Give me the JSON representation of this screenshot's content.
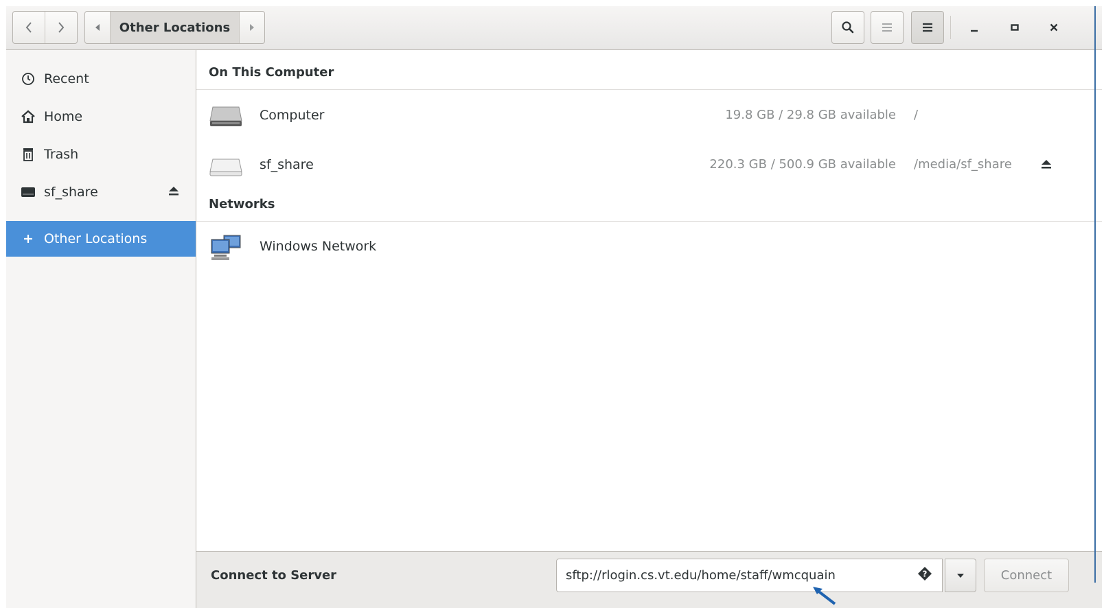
{
  "header": {
    "path_current": "Other Locations",
    "icons": {
      "back": "chevron-left-icon",
      "forward": "chevron-right-icon",
      "path_prev": "triangle-left-icon",
      "path_next": "triangle-right-icon",
      "search": "search-icon",
      "list_view": "list-view-icon",
      "menu": "hamburger-menu-icon",
      "minimize": "minimize-icon",
      "maximize": "maximize-icon",
      "close": "close-icon"
    }
  },
  "sidebar": {
    "items": [
      {
        "label": "Recent",
        "icon": "clock-icon"
      },
      {
        "label": "Home",
        "icon": "home-icon"
      },
      {
        "label": "Trash",
        "icon": "trash-icon"
      },
      {
        "label": "sf_share",
        "icon": "drive-icon",
        "eject_icon": "eject-icon"
      },
      {
        "label": "Other Locations",
        "icon": "plus-icon",
        "active": true
      }
    ]
  },
  "main": {
    "sections": [
      {
        "title": "On This Computer",
        "rows": [
          {
            "name": "Computer",
            "available": "19.8 GB / 29.8 GB available",
            "path": "/",
            "icon": "hard-drive-icon"
          },
          {
            "name": "sf_share",
            "available": "220.3 GB / 500.9 GB available",
            "path": "/media/sf_share",
            "icon": "drive-icon",
            "eject_icon": "eject-icon"
          }
        ]
      },
      {
        "title": "Networks",
        "rows": [
          {
            "name": "Windows Network",
            "icon": "network-computers-icon"
          }
        ]
      }
    ]
  },
  "bottom": {
    "label": "Connect to Server",
    "server_value": "sftp://rlogin.cs.vt.edu/home/staff/wmcquain",
    "server_placeholder": "",
    "connect_label": "Connect",
    "help_icon": "help-diamond-icon",
    "dropdown_icon": "dropdown-arrow-icon"
  },
  "colors": {
    "accent": "#4a90d9",
    "sidebar_bg": "#f6f5f4",
    "muted_text": "#8b8e8f"
  }
}
